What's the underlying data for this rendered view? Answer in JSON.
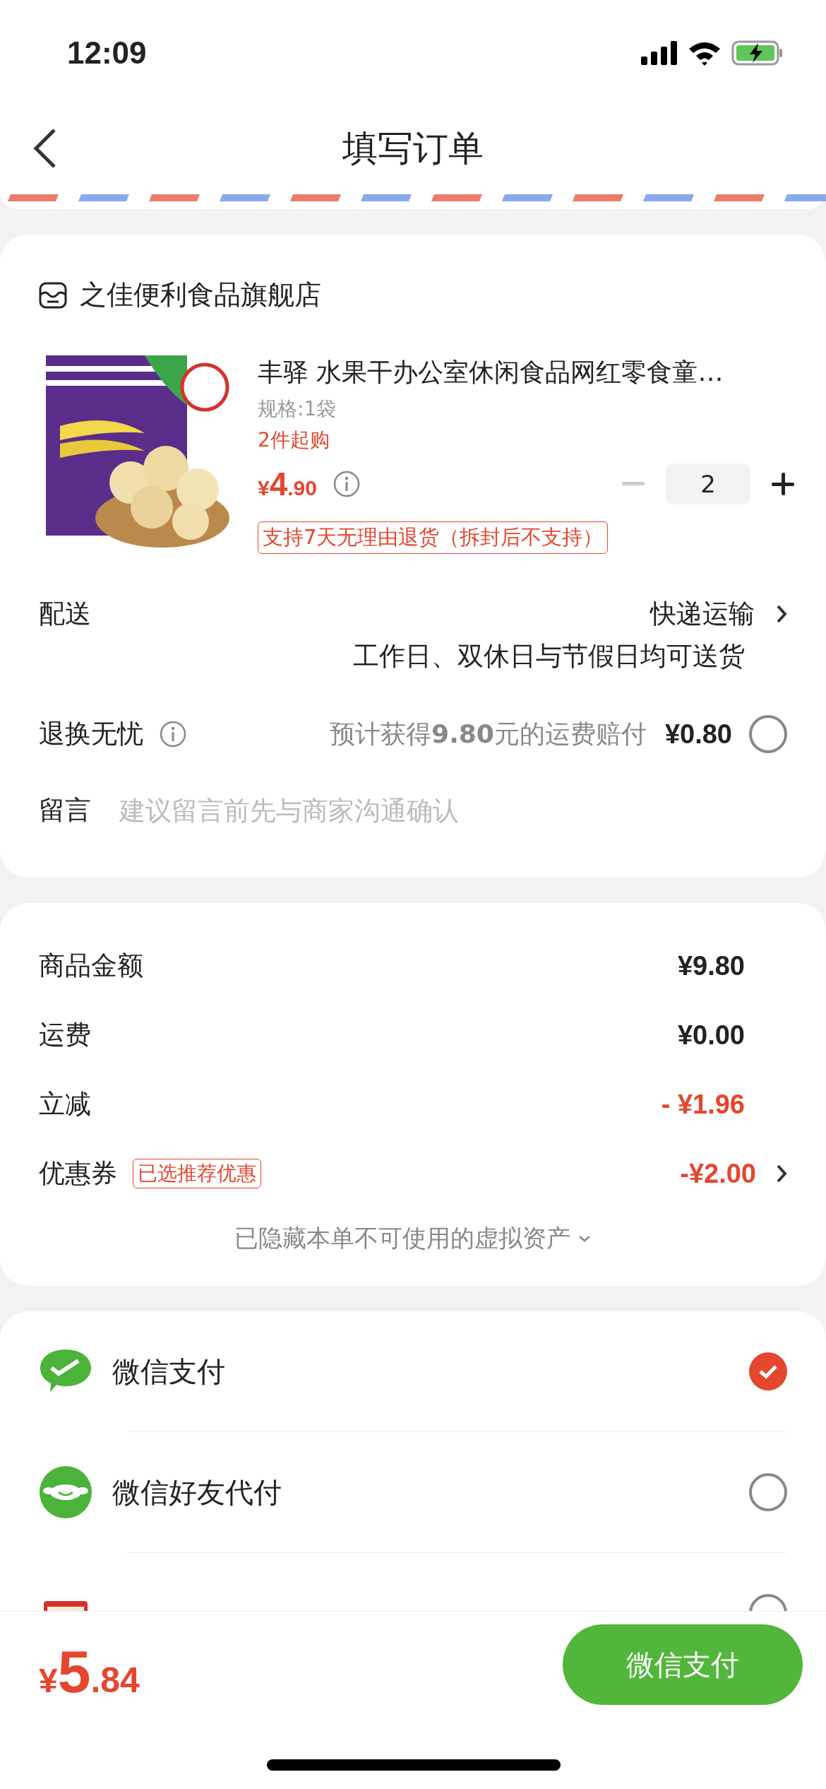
{
  "status_bar": {
    "time": "12:09"
  },
  "nav": {
    "title": "填写订单"
  },
  "store": {
    "name": "之佳便利食品旗舰店"
  },
  "product": {
    "title": "丰驿 水果干办公室休闲食品网红零食童…",
    "spec": "规格:1袋",
    "min_purchase": "2件起购",
    "price_symbol": "¥",
    "price_int": "4",
    "price_dec": ".90",
    "quantity": "2",
    "minus_disabled": true,
    "return_policy": "支持7天无理由退货（拆封后不支持）"
  },
  "delivery": {
    "label": "配送",
    "method": "快递运输",
    "note": "工作日、双休日与节假日均可送货"
  },
  "return_insurance": {
    "label": "退换无忧",
    "description": "预计获得**9.80**元的运费赔付",
    "price": "¥0.80",
    "selected": false
  },
  "message": {
    "label": "留言",
    "placeholder": "建议留言前先与商家沟通确认"
  },
  "summary": [
    {
      "label": "商品金额",
      "value": "¥9.80",
      "kind": "plain"
    },
    {
      "label": "运费",
      "value": "¥0.00",
      "kind": "plain"
    },
    {
      "label": "立减",
      "value": "- ¥1.96",
      "kind": "discount"
    },
    {
      "label": "优惠券",
      "tag": "已选推荐优惠",
      "value": "-¥2.00",
      "kind": "discount",
      "chevron": true
    }
  ],
  "hidden_assets": "已隐藏本单不可使用的虚拟资产",
  "payments": [
    {
      "name": "微信支付",
      "kind": "wechat",
      "selected": true
    },
    {
      "name": "微信好友代付",
      "kind": "friend",
      "selected": false
    },
    {
      "kind": "card",
      "selected": false
    }
  ],
  "footer": {
    "symbol": "¥",
    "int": "5",
    "dec": ".84",
    "button": "微信支付"
  }
}
